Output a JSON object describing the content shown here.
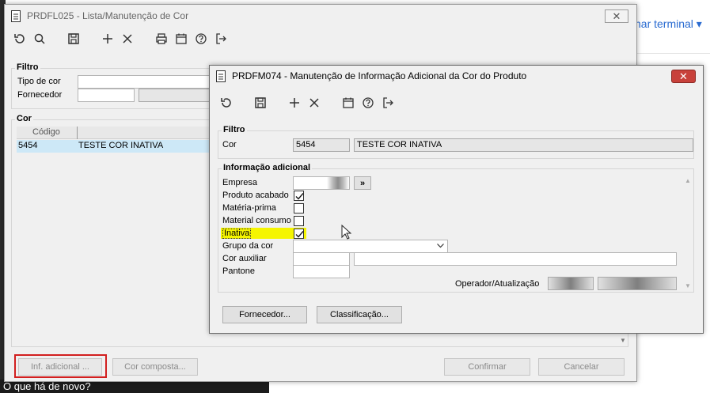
{
  "background": {
    "terminal_link": "nar terminal",
    "bottom_bar_text": "O que há de novo?"
  },
  "back_window": {
    "title": "PRDFL025 - Lista/Manutenção de Cor",
    "close_glyph": "✕",
    "filter_group": {
      "label": "Filtro",
      "tipo_label": "Tipo de cor",
      "fornecedor_label": "Fornecedor"
    },
    "cor_group": {
      "label": "Cor",
      "columns": [
        "Código",
        ""
      ],
      "rows": [
        {
          "codigo": "5454",
          "descricao": "TESTE COR INATIVA"
        }
      ]
    },
    "buttons": {
      "inf_adicional": "Inf. adicional ...",
      "cor_composta": "Cor composta...",
      "confirmar": "Confirmar",
      "cancelar": "Cancelar"
    }
  },
  "front_window": {
    "title": "PRDFM074 - Manutenção de Informação Adicional da Cor do Produto",
    "close_glyph": "✕",
    "filter_group": {
      "label": "Filtro",
      "cor_label": "Cor",
      "cor_code": "5454",
      "cor_desc": "TESTE COR INATIVA"
    },
    "info_group": {
      "label": "Informação adicional",
      "empresa_label": "Empresa",
      "empresa_button": "»",
      "produto_acabado_label": "Produto acabado",
      "produto_acabado_checked": true,
      "materia_prima_label": "Matéria-prima",
      "materia_prima_checked": false,
      "material_consumo_label": "Material consumo",
      "material_consumo_checked": false,
      "inativa_label": "Inativa",
      "inativa_checked": true,
      "grupo_label": "Grupo da cor",
      "cor_auxiliar_label": "Cor auxiliar",
      "pantone_label": "Pantone",
      "operador_label": "Operador/Atualização"
    },
    "buttons": {
      "fornecedor": "Fornecedor...",
      "classificacao": "Classificação..."
    }
  },
  "colors": {
    "highlight_yellow": "#f5f500",
    "selection_blue": "#cde8f7",
    "red_outline": "#d21f1f",
    "close_red": "#c8413b"
  }
}
